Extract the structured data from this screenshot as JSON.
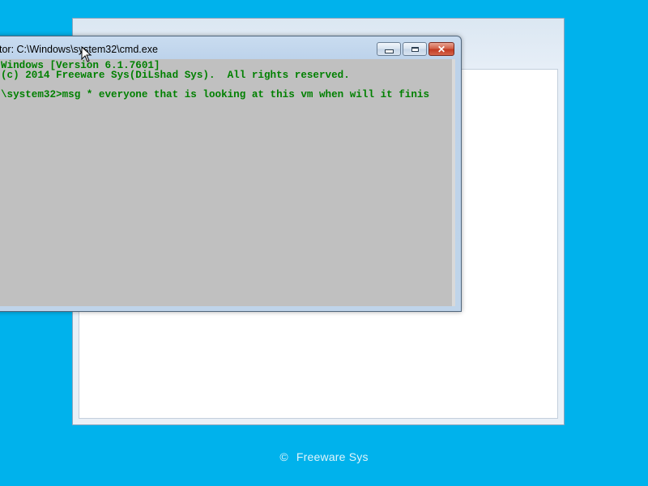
{
  "desktop": {
    "background_color": "#00b2ec"
  },
  "cmd_window": {
    "title": "tor: C:\\Windows\\system32\\cmd.exe",
    "console_lines": [
      "Windows [Version 6.1.7601]",
      "(c) 2014 Freeware Sys(DiLshad Sys).  All rights reserved.",
      "",
      "\\system32>msg * everyone that is looking at this vm when will it finis"
    ],
    "text_color": "#008000",
    "console_background": "#c0c0c0",
    "buttons": {
      "minimize": "minimize-icon",
      "maximize": "maximize-icon",
      "close": "close-icon"
    }
  },
  "footer": {
    "symbol": "©",
    "text": "Freeware Sys"
  }
}
